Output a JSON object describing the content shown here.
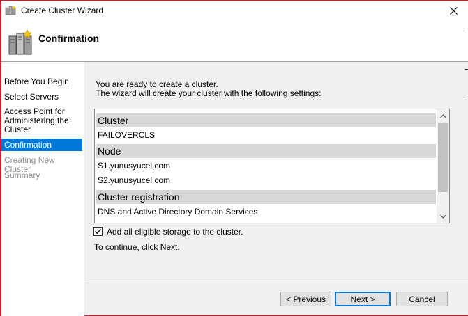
{
  "window": {
    "title": "Create Cluster Wizard",
    "close_glyph": "✕"
  },
  "header": {
    "title": "Confirmation",
    "icon": "cluster-servers-icon"
  },
  "nav": {
    "items": [
      {
        "label": "Before You Begin",
        "state": "normal"
      },
      {
        "label": "Select Servers",
        "state": "normal"
      },
      {
        "label": "Access Point for Administering the Cluster",
        "state": "normal"
      },
      {
        "label": "Confirmation",
        "state": "active"
      },
      {
        "label": "Creating New Cluster",
        "state": "disabled"
      },
      {
        "label": "Summary",
        "state": "disabled"
      }
    ]
  },
  "content": {
    "intro_line1": "You are ready to create a cluster.",
    "intro_line2": "The wizard will create your cluster with the following settings:",
    "settings": {
      "cluster_header": "Cluster",
      "cluster_name": "FAILOVERCLS",
      "node_header": "Node",
      "nodes": [
        "S1.yunusyucel.com",
        "S2.yunusyucel.com"
      ],
      "registration_header": "Cluster registration",
      "registration_value": "DNS and Active Directory Domain Services"
    },
    "storage_checkbox": {
      "label": "Add all eligible storage to the cluster.",
      "checked": true
    },
    "continue_text": "To continue, click Next."
  },
  "buttons": {
    "previous": "< Previous",
    "next": "Next >",
    "cancel": "Cancel"
  },
  "colors": {
    "accent": "#0078d7",
    "window_border": "#e81123",
    "group_header": "#d7d7d7"
  }
}
